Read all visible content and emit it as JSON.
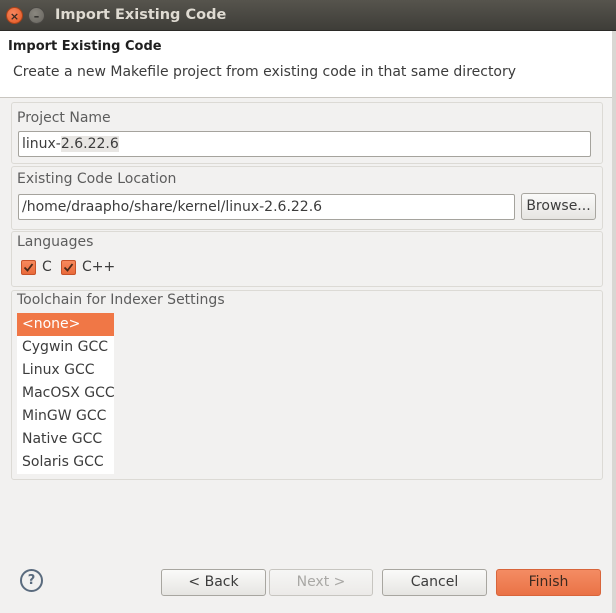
{
  "window": {
    "title": "Import Existing Code"
  },
  "banner": {
    "title": "Import Existing Code",
    "description": "Create a new Makefile project from existing code in that same directory"
  },
  "project_name": {
    "label": "Project Name",
    "value_prefix": "linux-",
    "value_selected": "2.6.22.6"
  },
  "code_location": {
    "label": "Existing Code Location",
    "value": "/home/draapho/share/kernel/linux-2.6.22.6",
    "browse_label": "Browse..."
  },
  "languages": {
    "label": "Languages",
    "items": [
      {
        "label": "C",
        "checked": true
      },
      {
        "label": "C++",
        "checked": true
      }
    ]
  },
  "toolchain": {
    "label": "Toolchain for Indexer Settings",
    "selected_index": 0,
    "items": [
      "<none>",
      "Cygwin GCC",
      "Linux GCC",
      "MacOSX GCC",
      "MinGW GCC",
      "Native GCC",
      "Solaris GCC"
    ]
  },
  "footer": {
    "help_icon": "help-icon",
    "back_label": "< Back",
    "next_label": "Next >",
    "cancel_label": "Cancel",
    "finish_label": "Finish"
  },
  "colors": {
    "accent": "#f07746",
    "titlebar": "#4a4843",
    "background": "#f2f1f0"
  }
}
